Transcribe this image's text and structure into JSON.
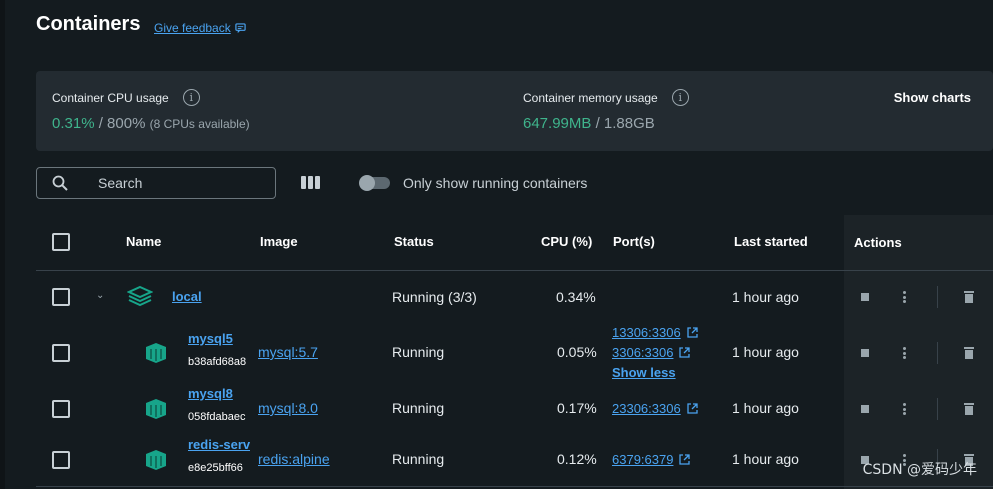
{
  "page": {
    "title": "Containers",
    "feedback_label": "Give feedback"
  },
  "stats": {
    "cpu": {
      "label": "Container CPU usage",
      "used": "0.31%",
      "total": "/ 800%",
      "note": "(8 CPUs available)"
    },
    "memory": {
      "label": "Container memory usage",
      "used": "647.99MB",
      "total": "/ 1.88GB"
    },
    "show_charts": "Show charts"
  },
  "toolbar": {
    "search_placeholder": "Search",
    "running_only_label": "Only show running containers"
  },
  "table": {
    "headers": {
      "name": "Name",
      "image": "Image",
      "status": "Status",
      "cpu": "CPU (%)",
      "ports": "Port(s)",
      "last_started": "Last started",
      "actions": "Actions"
    },
    "group": {
      "name": "local",
      "status": "Running (3/3)",
      "cpu": "0.34%",
      "last_started": "1 hour ago"
    },
    "rows": [
      {
        "name": "mysql5",
        "id": "b38afd68a8",
        "image": "mysql:5.7",
        "status": "Running",
        "cpu": "0.05%",
        "ports": [
          "13306:3306",
          "3306:3306"
        ],
        "show_less": "Show less",
        "last_started": "1 hour ago"
      },
      {
        "name": "mysql8",
        "id": "058fdabaec",
        "image": "mysql:8.0",
        "status": "Running",
        "cpu": "0.17%",
        "ports": [
          "23306:3306"
        ],
        "last_started": "1 hour ago"
      },
      {
        "name": "redis-serv",
        "id": "e8e25bff66",
        "image": "redis:alpine",
        "status": "Running",
        "cpu": "0.12%",
        "ports": [
          "6379:6379"
        ],
        "last_started": "1 hour ago"
      }
    ]
  },
  "watermark": "CSDN @爱码少年",
  "colors": {
    "accent_green": "#3fb48c",
    "link_blue": "#4aa3f0",
    "container_teal": "#17a58a"
  }
}
